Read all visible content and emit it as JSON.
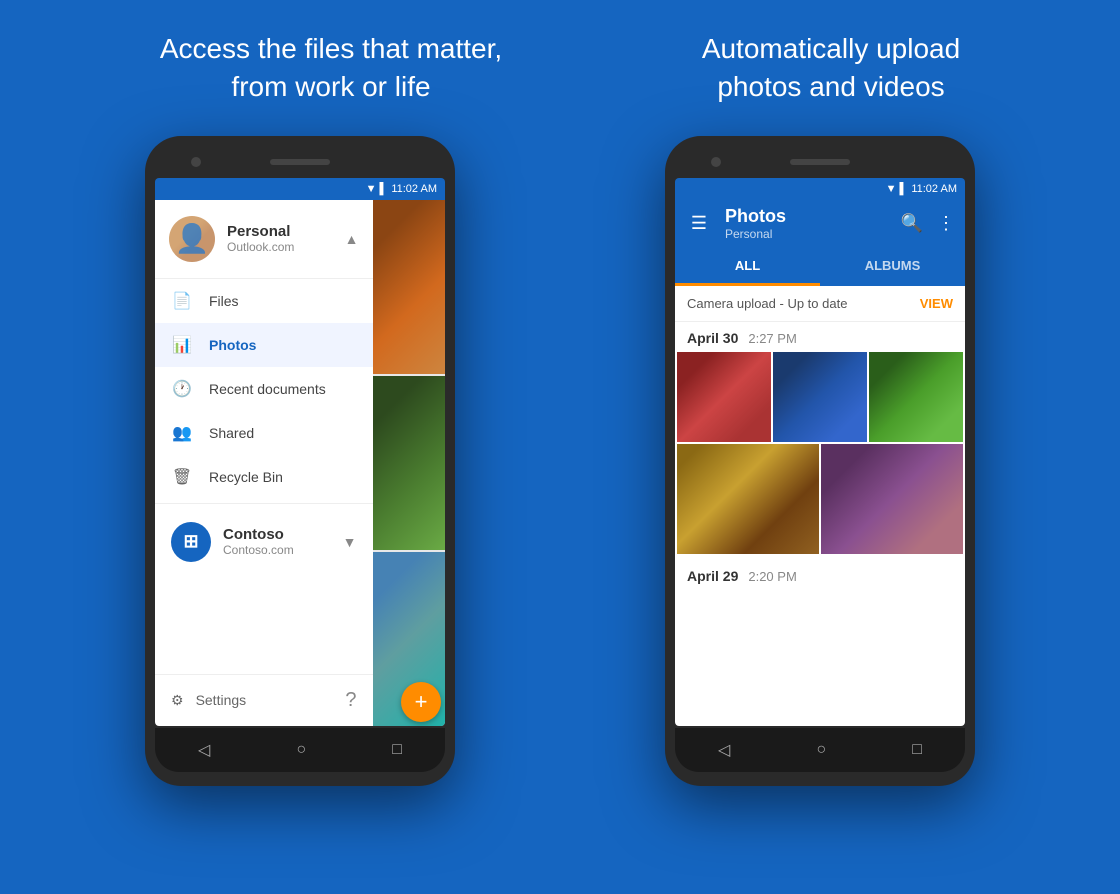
{
  "page": {
    "background": "#1565C0"
  },
  "left_headline": "Access the files that matter,\nfrom work or life",
  "right_headline": "Automatically upload\nphotos and videos",
  "left_phone": {
    "status_time": "11:02 AM",
    "drawer": {
      "account_name": "Personal",
      "account_email": "Outlook.com",
      "menu_items": [
        {
          "label": "Files",
          "icon": "file",
          "active": false
        },
        {
          "label": "Photos",
          "icon": "photo",
          "active": true
        },
        {
          "label": "Recent documents",
          "icon": "clock",
          "active": false
        },
        {
          "label": "Shared",
          "icon": "people",
          "active": false
        },
        {
          "label": "Recycle Bin",
          "icon": "trash",
          "active": false
        }
      ],
      "second_account": {
        "name": "Contoso",
        "domain": "Contoso.com"
      },
      "settings_label": "Settings",
      "help_label": "?"
    }
  },
  "right_phone": {
    "status_time": "11:02 AM",
    "toolbar": {
      "title": "Photos",
      "subtitle": "Personal"
    },
    "tabs": [
      "ALL",
      "ALBUMS"
    ],
    "active_tab": "ALL",
    "camera_upload": {
      "text": "Camera upload - Up to date",
      "action": "VIEW"
    },
    "photo_groups": [
      {
        "date": "April 30",
        "time": "2:27 PM"
      },
      {
        "date": "April 29",
        "time": "2:20 PM"
      }
    ]
  }
}
